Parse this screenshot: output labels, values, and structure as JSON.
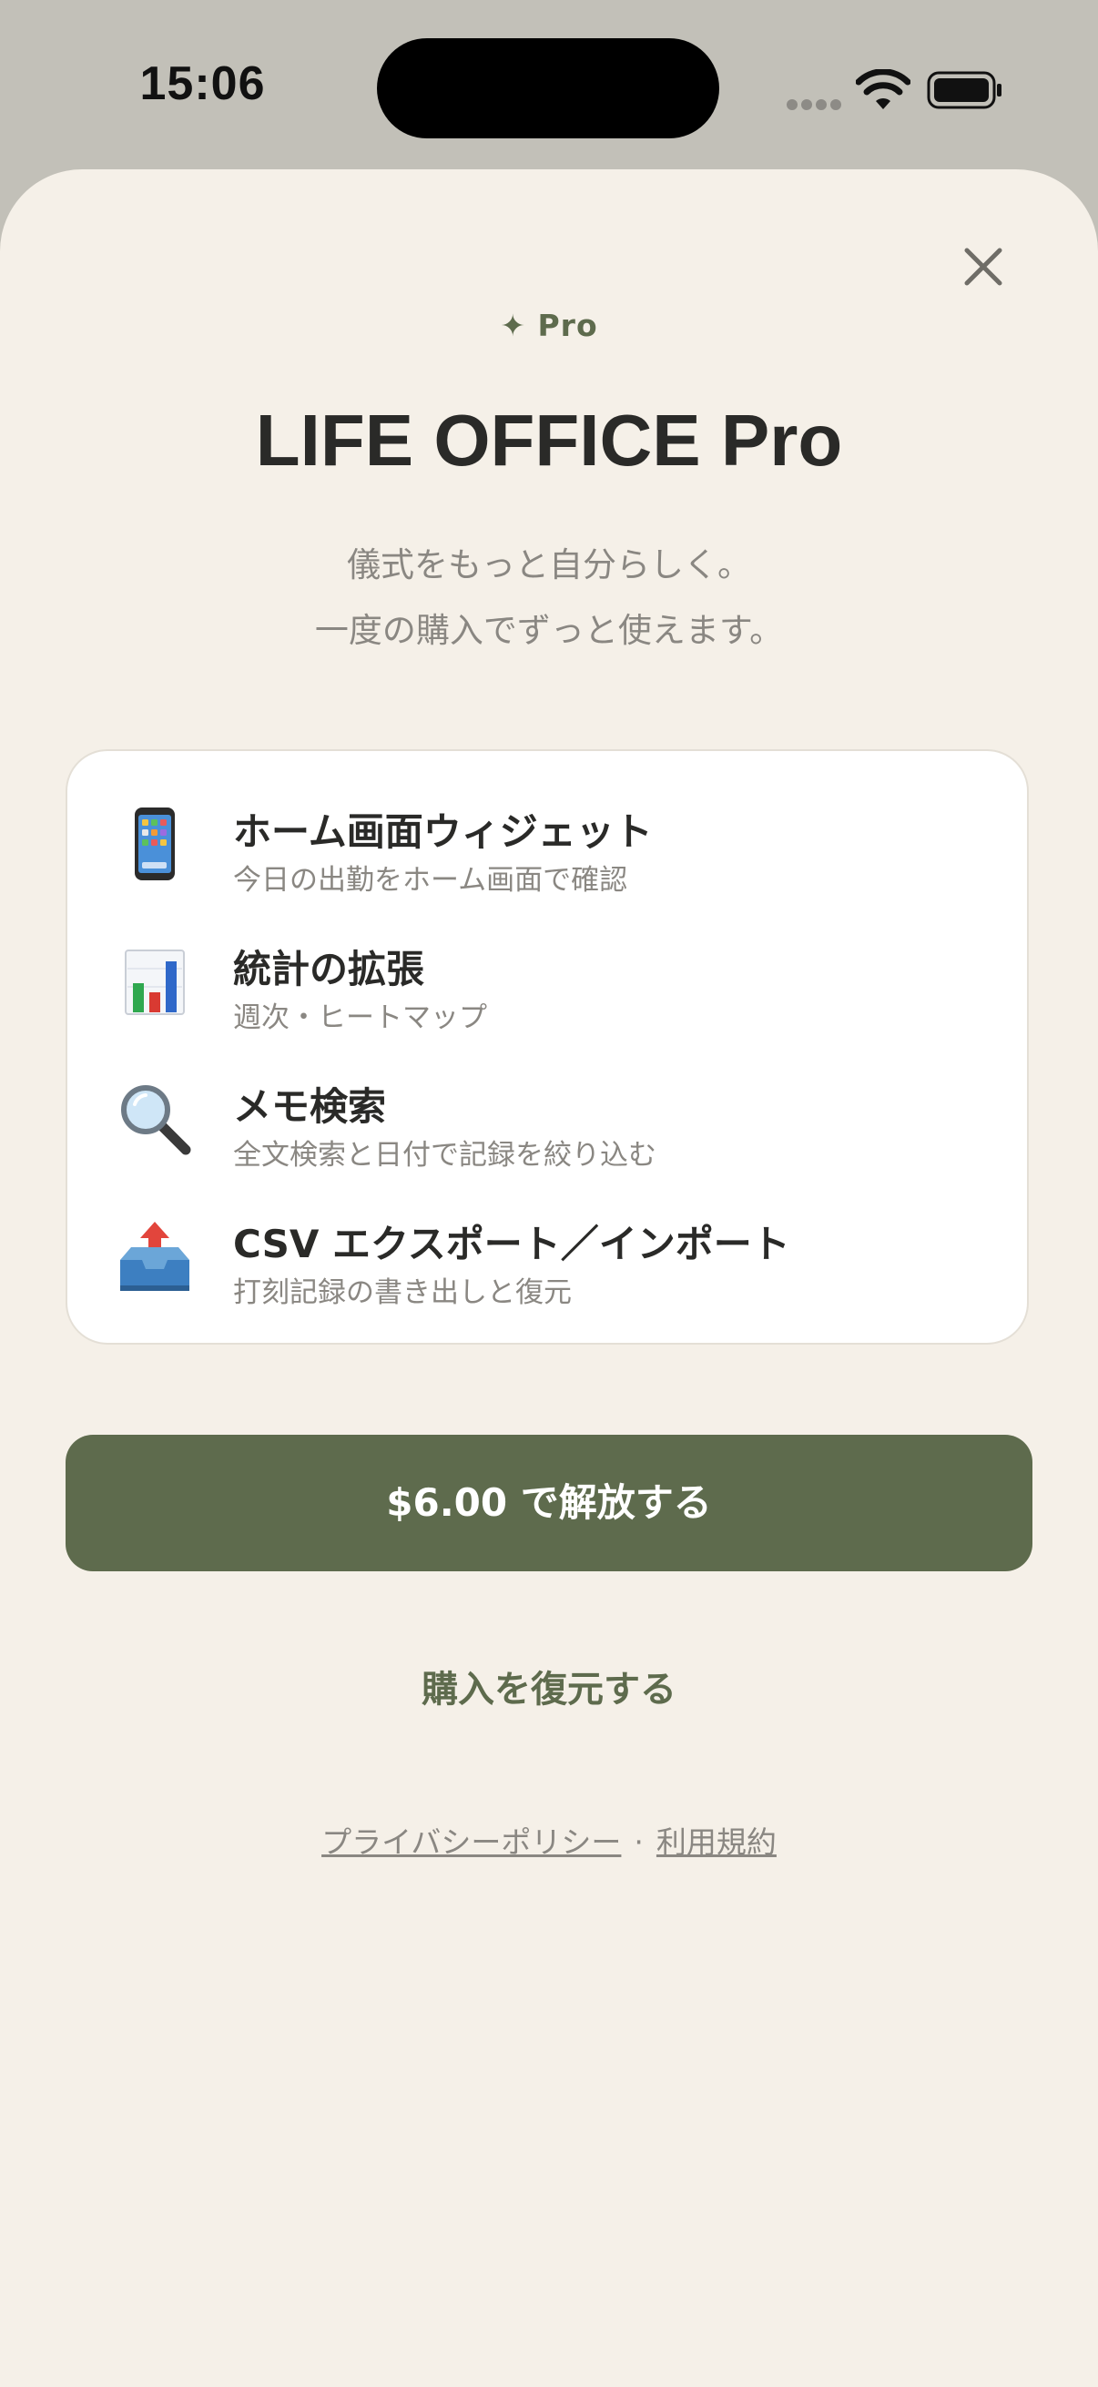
{
  "status_bar": {
    "time": "15:06"
  },
  "paywall": {
    "badge": "✦ Pro",
    "title": "LIFE OFFICE Pro",
    "subtitle_line1": "儀式をもっと自分らしく。",
    "subtitle_line2": "一度の購入でずっと使えます。",
    "features": [
      {
        "icon": "mobile-phone-icon",
        "title": "ホーム画面ウィジェット",
        "description": "今日の出勤をホーム画面で確認"
      },
      {
        "icon": "bar-chart-icon",
        "title": "統計の拡張",
        "description": "週次・ヒートマップ"
      },
      {
        "icon": "magnifying-glass-icon",
        "title": "メモ検索",
        "description": "全文検索と日付で記録を絞り込む"
      },
      {
        "icon": "outbox-tray-icon",
        "title": "CSV エクスポート／インポート",
        "description": "打刻記録の書き出しと復元"
      }
    ],
    "buy_label": "$6.00 で解放する",
    "restore_label": "購入を復元する",
    "privacy_label": "プライバシーポリシー",
    "separator": "·",
    "terms_label": "利用規約"
  },
  "colors": {
    "accent": "#5e6b4d",
    "sheet_background": "#f5f0e8",
    "backdrop": "#c2c0b8"
  }
}
